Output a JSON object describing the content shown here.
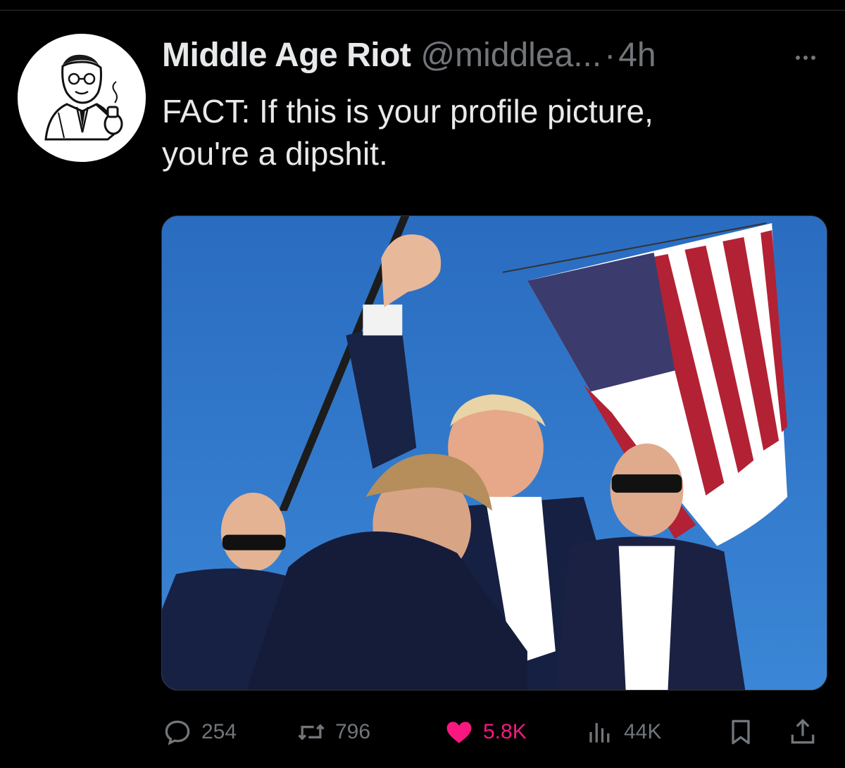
{
  "tweet": {
    "author": {
      "display_name": "Middle Age Riot",
      "handle": "@middlea...",
      "avatar_icon": "vintage-man-with-pipe-illustration"
    },
    "separator": "·",
    "time": "4h",
    "more_icon": "ellipsis-icon",
    "text_lines": [
      "FACT: If this is your profile picture,",
      "you're a dipshit."
    ],
    "media": {
      "kind": "photo"
    },
    "actions": {
      "reply": {
        "icon": "reply-icon",
        "count": "254"
      },
      "retweet": {
        "icon": "retweet-icon",
        "count": "796"
      },
      "like": {
        "icon": "heart-icon",
        "count": "5.8K",
        "active": true,
        "color": "#f91880"
      },
      "views": {
        "icon": "views-icon",
        "count": "44K"
      },
      "bookmark": {
        "icon": "bookmark-icon"
      },
      "share": {
        "icon": "share-icon"
      }
    }
  },
  "colors": {
    "background": "#000000",
    "primary_text": "#e7e9ea",
    "secondary_text": "#71767b",
    "like": "#f91880",
    "divider": "#2f3336"
  }
}
